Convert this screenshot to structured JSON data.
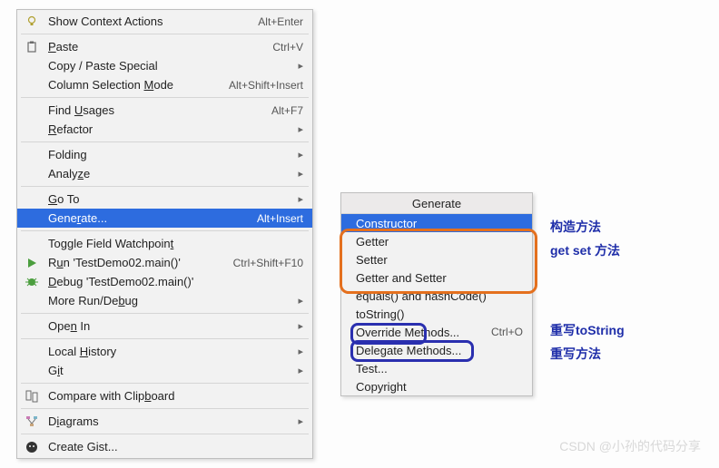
{
  "menu": {
    "items": [
      {
        "label_html": "Show Context Actions",
        "shortcut": "Alt+Enter",
        "icon": "bulb"
      },
      {
        "sep": true
      },
      {
        "label_html": "<span class='underline'>P</span>aste",
        "shortcut": "Ctrl+V",
        "icon": "paste"
      },
      {
        "label_html": "Copy / Paste Special",
        "arrow": true
      },
      {
        "label_html": "Column Selection <span class='underline'>M</span>ode",
        "shortcut": "Alt+Shift+Insert"
      },
      {
        "sep": true
      },
      {
        "label_html": "Find <span class='underline'>U</span>sages",
        "shortcut": "Alt+F7"
      },
      {
        "label_html": "<span class='underline'>R</span>efactor",
        "arrow": true
      },
      {
        "sep": true
      },
      {
        "label_html": "Folding",
        "arrow": true
      },
      {
        "label_html": "Analy<span class='underline'>z</span>e",
        "arrow": true
      },
      {
        "sep": true
      },
      {
        "label_html": "<span class='underline'>G</span>o To",
        "arrow": true
      },
      {
        "label_html": "Gene<span class='underline'>r</span>ate...",
        "shortcut": "Alt+Insert",
        "highlight": true
      },
      {
        "sep": true
      },
      {
        "label_html": "Toggle Field Watchpoin<span class='underline'>t</span>"
      },
      {
        "label_html": "R<span class='underline'>u</span>n 'TestDemo02.main()'",
        "shortcut": "Ctrl+Shift+F10",
        "icon": "play"
      },
      {
        "label_html": "<span class='underline'>D</span>ebug 'TestDemo02.main()'",
        "icon": "bug"
      },
      {
        "label_html": "More Run/De<span class='underline'>b</span>ug",
        "arrow": true
      },
      {
        "sep": true
      },
      {
        "label_html": "Ope<span class='underline'>n</span> In",
        "arrow": true
      },
      {
        "sep": true
      },
      {
        "label_html": "Local <span class='underline'>H</span>istory",
        "arrow": true
      },
      {
        "label_html": "G<span class='underline'>i</span>t",
        "arrow": true
      },
      {
        "sep": true
      },
      {
        "label_html": "Compare with Clip<span class='underline'>b</span>oard",
        "icon": "compare"
      },
      {
        "sep": true
      },
      {
        "label_html": "D<span class='underline'>i</span>agrams",
        "arrow": true,
        "icon": "diagram"
      },
      {
        "sep": true
      },
      {
        "label_html": "Create Gist...",
        "icon": "github"
      }
    ]
  },
  "submenu": {
    "title": "Generate",
    "items": [
      {
        "label": "Constructor",
        "highlight": true
      },
      {
        "label": "Getter"
      },
      {
        "label": "Setter"
      },
      {
        "label": "Getter and Setter"
      },
      {
        "label": "equals() and hashCode()"
      },
      {
        "label": "toString()"
      },
      {
        "label": "Override Methods...",
        "shortcut": "Ctrl+O"
      },
      {
        "label": "Delegate Methods..."
      },
      {
        "label": "Test..."
      },
      {
        "label": "Copyright"
      }
    ]
  },
  "annotations": {
    "a1": "构造方法",
    "a2": "get set 方法",
    "a3": "重写toString",
    "a4": "重写方法"
  },
  "watermark": "CSDN @小孙的代码分享"
}
